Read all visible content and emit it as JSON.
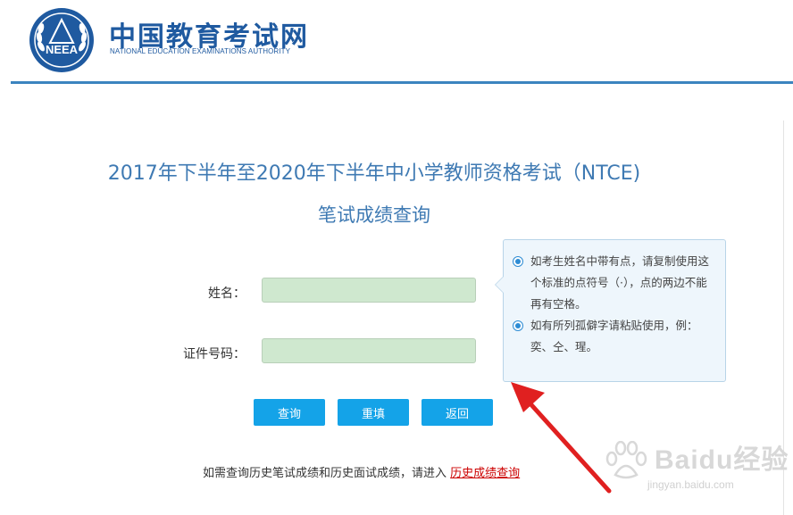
{
  "header": {
    "logo_text_cn": "中国教育考试网",
    "logo_text_en": "NATIONAL EDUCATION EXAMINATIONS AUTHORITY",
    "emblem_text": "NEEA"
  },
  "page": {
    "title_line1": "2017年下半年至2020年下半年中小学教师资格考试（NTCE)",
    "title_line2": "笔试成绩查询"
  },
  "form": {
    "name_label": "姓名：",
    "name_value": "",
    "id_label": "证件号码：",
    "id_value": "",
    "buttons": {
      "query": "查询",
      "reset": "重填",
      "back": "返回"
    }
  },
  "tip": {
    "items": [
      "如考生姓名中带有点，请复制使用这个标准的点符号（·），点的两边不能再有空格。",
      "如有所列孤僻字请粘贴使用，例：奕、仝、瑆。"
    ]
  },
  "footer": {
    "note_text": "如需查询历史笔试成绩和历史面试成绩，请进入",
    "history_link": "历史成绩查询"
  },
  "watermark": {
    "brand": "Baidu经验",
    "url": "jingyan.baidu.com"
  },
  "colors": {
    "brand_blue": "#1f5aa0",
    "title_blue": "#3f7ab3",
    "button_blue": "#14a3e8",
    "input_green": "#cfe8cf",
    "link_red": "#cc0000",
    "arrow_red": "#e02020"
  }
}
